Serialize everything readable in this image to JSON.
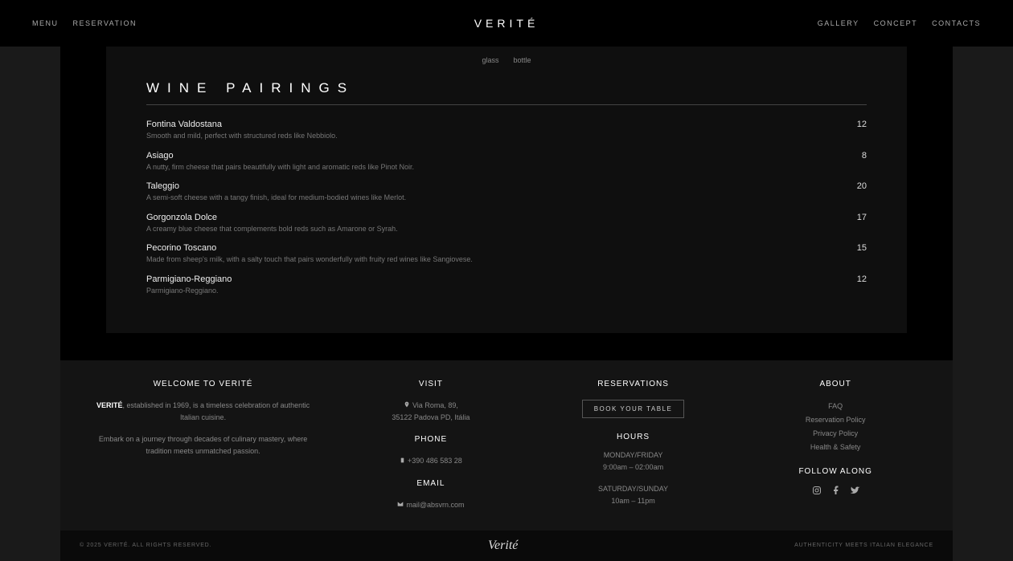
{
  "nav": {
    "left": [
      "Menu",
      "Reservation"
    ],
    "logo": "VERITÉ",
    "right": [
      "Gallery",
      "Concept",
      "Contacts"
    ]
  },
  "wine_columns": {
    "glass": "glass",
    "bottle": "bottle"
  },
  "section_title": "WINE PAIRINGS",
  "wines": [
    {
      "name": "Fontina Valdostana",
      "desc": "Smooth and mild, perfect with structured reds like Nebbiolo.",
      "price": "12"
    },
    {
      "name": "Asiago",
      "desc": "A nutty, firm cheese that pairs beautifully with light and aromatic reds like Pinot Noir.",
      "price": "8"
    },
    {
      "name": "Taleggio",
      "desc": "A semi-soft cheese with a tangy finish, ideal for medium-bodied wines like Merlot.",
      "price": "20"
    },
    {
      "name": "Gorgonzola Dolce",
      "desc": "A creamy blue cheese that complements bold reds such as Amarone or Syrah.",
      "price": "17"
    },
    {
      "name": "Pecorino Toscano",
      "desc": "Made from sheep's milk, with a salty touch that pairs wonderfully with fruity red wines like Sangiovese.",
      "price": "15"
    },
    {
      "name": "Parmigiano-Reggiano",
      "desc": "Parmigiano-Reggiano.",
      "price": "12"
    }
  ],
  "footer": {
    "welcome": {
      "heading": "Welcome to Verité",
      "brand": "VERITÉ",
      "para1": ", established in 1969, is a timeless celebration of authentic Italian cuisine.",
      "para2": "Embark on a journey through decades of culinary mastery, where tradition meets unmatched passion."
    },
    "visit": {
      "heading": "VISIT",
      "addr1": "Via Roma, 89,",
      "addr2": "35122 Padova PD, Itália",
      "phone_heading": "PHONE",
      "phone": "+390 486 583 28",
      "email_heading": "EMAIL",
      "email": "mail@absvrn.com"
    },
    "reservations": {
      "heading": "RESERVATIONS",
      "book_btn": "BOOK YOUR TABLE",
      "hours_heading": "HOURS",
      "weekday": "MONDAY/FRIDAY",
      "weekday_hours": "9:00am – 02:00am",
      "weekend": "SATURDAY/SUNDAY",
      "weekend_hours": "10am – 11pm"
    },
    "about": {
      "heading": "ABOUT",
      "links": [
        "FAQ",
        "Reservation Policy",
        "Privacy Policy",
        "Health & Safety"
      ],
      "follow_heading": "FOLLOW ALONG"
    }
  },
  "bottom": {
    "left": "© 2025 Verité. All Rights Reserved.",
    "logo": "Verité",
    "right": "AUTHENTICITY MEETS ITALIAN ELEGANCE"
  }
}
